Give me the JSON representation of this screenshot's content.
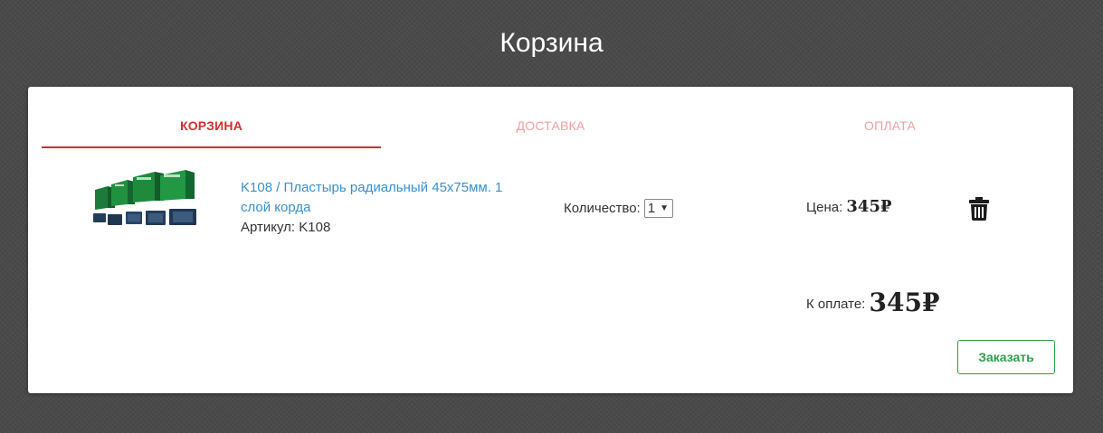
{
  "page": {
    "title": "Корзина"
  },
  "steps": [
    {
      "label": "Корзина",
      "active": true
    },
    {
      "label": "Доставка",
      "active": false
    },
    {
      "label": "Оплата",
      "active": false
    }
  ],
  "cart": {
    "items": [
      {
        "title": "K108 / Пластырь радиальный 45x75мм. 1 слой корда",
        "sku_label": "Артикул:",
        "sku": "K108",
        "quantity_label": "Количество:",
        "quantity": "1",
        "price_label": "Цена:",
        "price": "345₽"
      }
    ],
    "total_label": "К оплате:",
    "total": "345₽",
    "order_button": "Заказать"
  },
  "colors": {
    "accent_red": "#d32f2f",
    "inactive_step": "#f0a0a0",
    "link_blue": "#3a8fd0",
    "order_green": "#2e9e4e"
  },
  "icons": {
    "delete": "trash-icon",
    "product": "product-image"
  }
}
